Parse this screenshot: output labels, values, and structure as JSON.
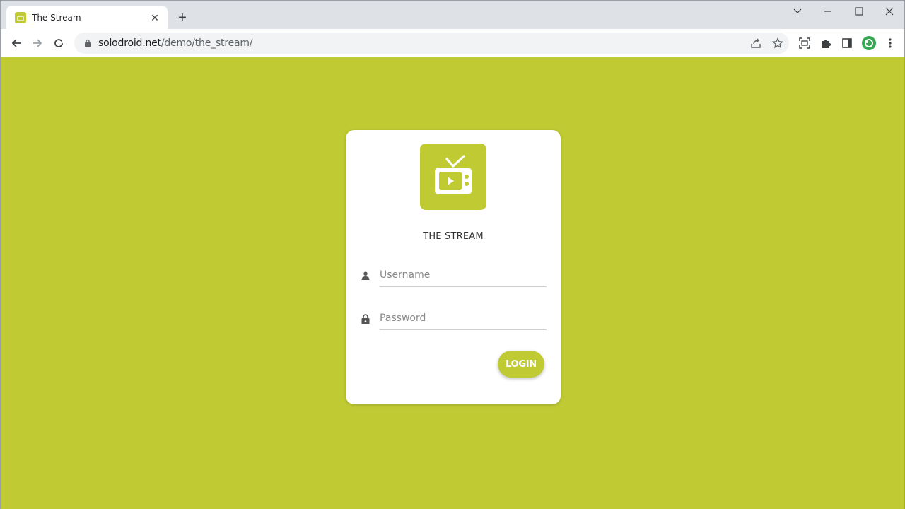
{
  "browser": {
    "tab": {
      "title": "The Stream",
      "close_glyph": "✕",
      "favicon": "tv-icon"
    },
    "new_tab_glyph": "+",
    "window_controls": [
      "chevron-down-icon",
      "minimize-icon",
      "maximize-icon",
      "close-icon"
    ],
    "address": {
      "host": "solodroid.net",
      "path": "/demo/the_stream/"
    }
  },
  "login": {
    "app_name": "THE STREAM",
    "username_placeholder": "Username",
    "password_placeholder": "Password",
    "button_label": "LOGIN"
  },
  "colors": {
    "accent": "#c0ca33",
    "card": "#ffffff",
    "text": "#333333"
  }
}
